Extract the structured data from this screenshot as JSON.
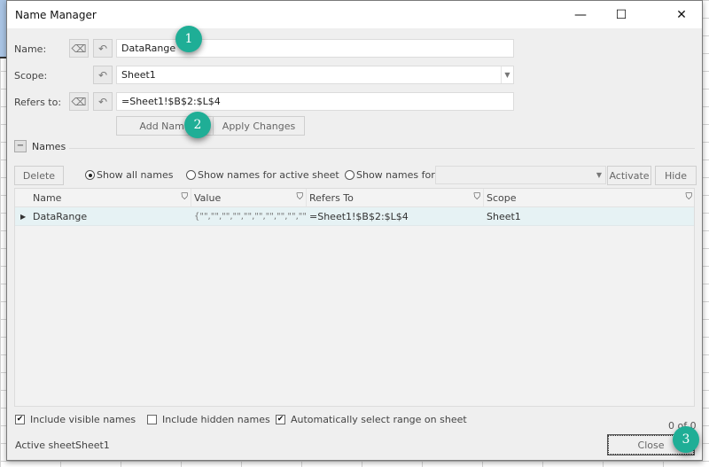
{
  "dialog": {
    "title": "Name Manager",
    "window_controls": {
      "minimize": "—",
      "maximize": "☐",
      "close": "✕"
    }
  },
  "form": {
    "name_label": "Name:",
    "name_value": "DataRange",
    "scope_label": "Scope:",
    "scope_value": "Sheet1",
    "refers_label": "Refers to:",
    "refers_value": "=Sheet1!$B$2:$L$4",
    "add_name": "Add Name",
    "apply_changes": "Apply Changes",
    "icons": {
      "eraser": "⌫",
      "undo": "↶",
      "dropdown": "▼"
    }
  },
  "names_section": {
    "toggle": "−",
    "label": "Names",
    "delete": "Delete",
    "radios": [
      {
        "label": "Show all names",
        "selected": true
      },
      {
        "label": "Show names for active sheet",
        "selected": false
      },
      {
        "label": "Show names for:",
        "selected": false
      }
    ],
    "show_for_value": "",
    "activate": "Activate",
    "hide": "Hide"
  },
  "table": {
    "columns": [
      "Name",
      "Value",
      "Refers To",
      "Scope"
    ],
    "filter_icon": "⛉",
    "rows": [
      {
        "name": "DataRange",
        "value": "{\"\",\"\",\"\",\"\",\"\",\"\",\"\",\"\",\"\",\"\",\"\",...",
        "refers_to": "=Sheet1!$B$2:$L$4",
        "scope": "Sheet1"
      }
    ]
  },
  "footer": {
    "checkboxes": [
      {
        "label": "Include visible names",
        "checked": true
      },
      {
        "label": "Include hidden names",
        "checked": false
      },
      {
        "label": "Automatically select range on sheet",
        "checked": true
      }
    ],
    "count": "0 of 0",
    "active_sheet_label": "Active sheet:",
    "active_sheet_value": "Sheet1",
    "close": "Close"
  },
  "annotations": [
    "1",
    "2",
    "3"
  ],
  "colors": {
    "badge": "#1fae96",
    "row_highlight": "#e6f2f4"
  }
}
